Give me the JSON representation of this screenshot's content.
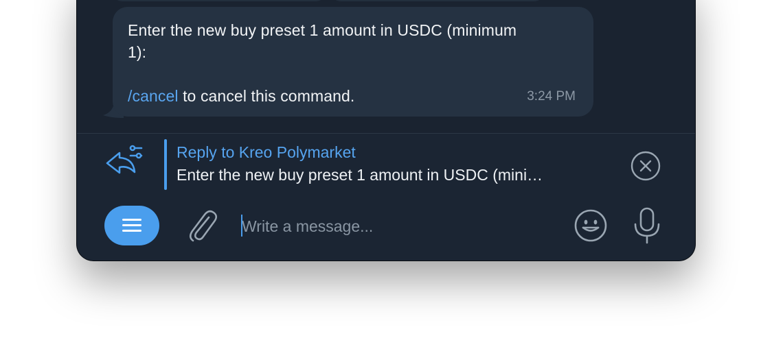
{
  "message": {
    "line1": "Enter the new buy preset 1 amount in USDC (minimum",
    "line2": "1):",
    "cancel_command": "/cancel",
    "cancel_rest": " to cancel this command.",
    "time": "3:24 PM"
  },
  "reply": {
    "title": "Reply to Kreo Polymarket",
    "preview": "Enter the new buy preset 1 amount in USDC (mini…"
  },
  "composer": {
    "placeholder": "Write a message..."
  },
  "icons": {
    "reply": "reply-options-icon",
    "close": "close-circle-icon",
    "menu": "menu-icon",
    "attach": "paperclip-icon",
    "emoji": "emoji-icon",
    "mic": "microphone-icon"
  },
  "colors": {
    "accent": "#4a9eed",
    "link": "#5aa6f0",
    "bubble": "#253242",
    "background": "#1b2533"
  }
}
